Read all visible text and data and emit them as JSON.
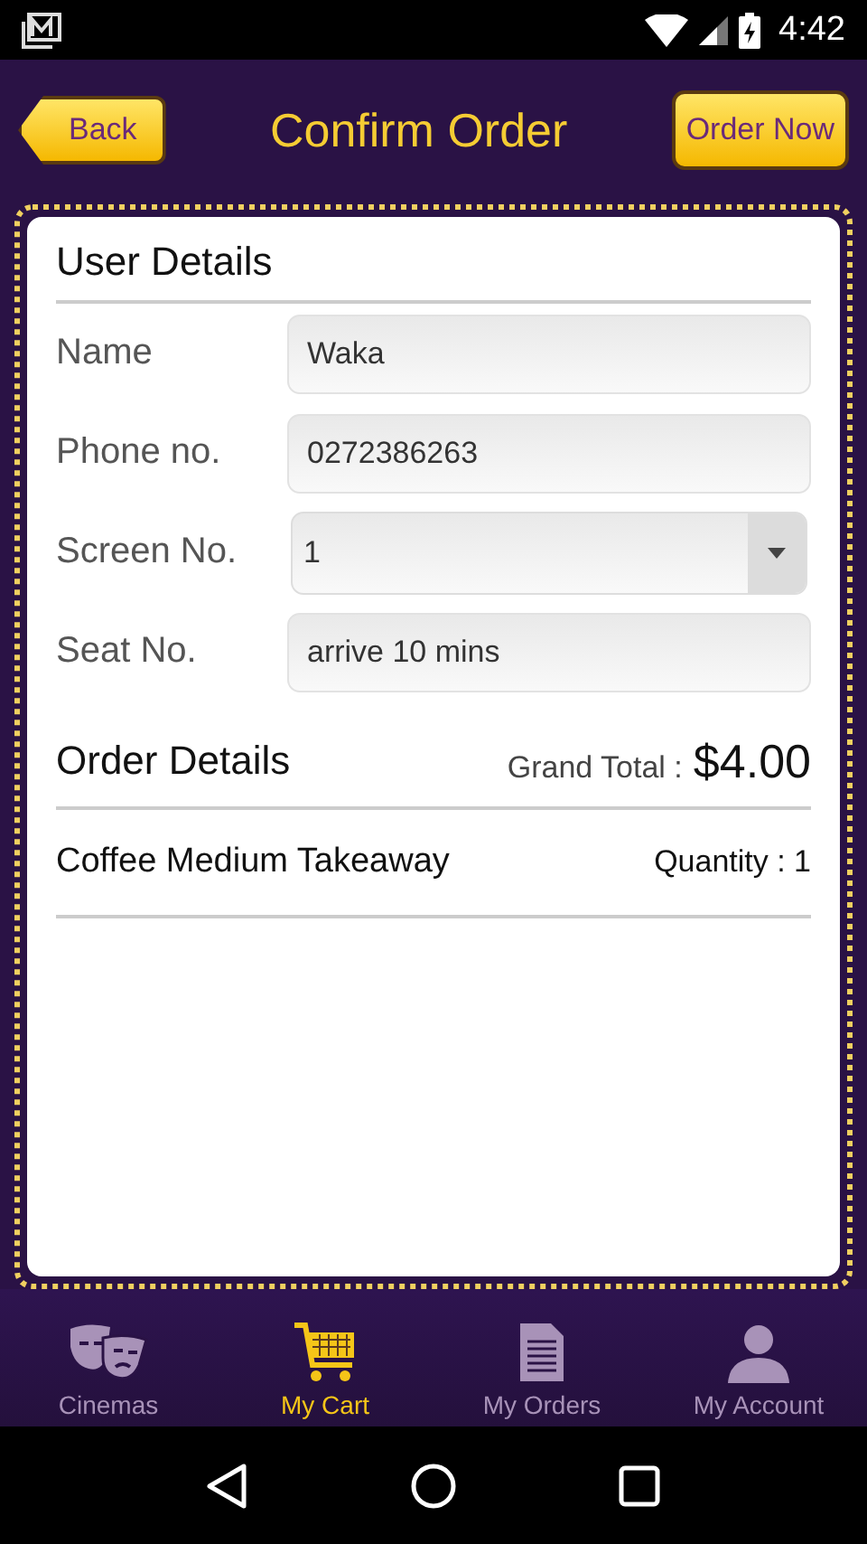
{
  "status_bar": {
    "time": "4:42"
  },
  "header": {
    "back": "Back",
    "title": "Confirm Order",
    "action": "Order Now"
  },
  "user_details": {
    "heading": "User Details",
    "fields": [
      {
        "label": "Name",
        "kind": "text",
        "value": "Waka"
      },
      {
        "label": "Phone no.",
        "kind": "text",
        "value": "0272386263"
      },
      {
        "label": "Screen No.",
        "kind": "dropdown",
        "value": "1"
      },
      {
        "label": "Seat No.",
        "kind": "text",
        "value": "arrive 10 mins"
      }
    ]
  },
  "order_details": {
    "heading": "Order Details",
    "total_label": "Grand Total :",
    "total": "$4.00",
    "items": [
      {
        "name": "Coffee Medium Takeaway",
        "quantity": "Quantity : 1"
      }
    ]
  },
  "tabs": [
    {
      "label": "Cinemas",
      "kind": "masks",
      "selected": false
    },
    {
      "label": "My Cart",
      "kind": "cart",
      "selected": true
    },
    {
      "label": "My Orders",
      "kind": "document",
      "selected": false
    },
    {
      "label": "My Account",
      "kind": "person",
      "selected": false
    }
  ]
}
